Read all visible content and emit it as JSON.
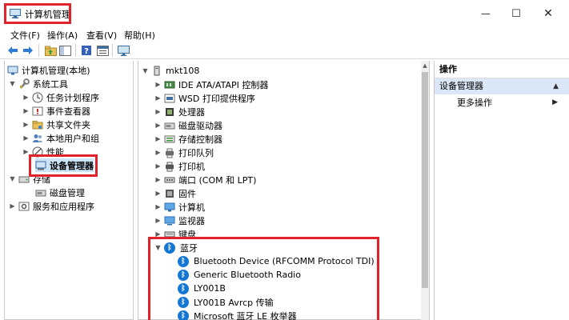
{
  "window": {
    "title": "计算机管理",
    "minimize_glyph": "—",
    "maximize_glyph": "☐",
    "close_glyph": "✕"
  },
  "menu": [
    "文件(F)",
    "操作(A)",
    "查看(V)",
    "帮助(H)"
  ],
  "toolbar": {
    "icons": [
      "back-arrow-icon",
      "forward-arrow-icon",
      "up-folder-icon",
      "show-hide-tree-icon",
      "help-icon",
      "properties-icon",
      "console-icon"
    ]
  },
  "left_tree": {
    "root": "计算机管理(本地)",
    "system_tools": "系统工具",
    "task_scheduler": "任务计划程序",
    "event_viewer": "事件查看器",
    "shared_folders": "共享文件夹",
    "local_users": "本地用户和组",
    "performance": "性能",
    "device_manager": "设备管理器",
    "storage": "存储",
    "disk_management": "磁盘管理",
    "services_apps": "服务和应用程序"
  },
  "center_tree": {
    "computer_name": "mkt108",
    "categories": [
      "IDE ATA/ATAPI 控制器",
      "WSD 打印提供程序",
      "处理器",
      "磁盘驱动器",
      "存储控制器",
      "打印队列",
      "打印机",
      "端口 (COM 和 LPT)",
      "固件",
      "计算机",
      "监视器",
      "键盘"
    ],
    "bluetooth": "蓝牙",
    "bluetooth_devices": [
      "Bluetooth Device (RFCOMM Protocol TDI)",
      "Generic Bluetooth Radio",
      "LY001B",
      "LY001B Avrcp 传输",
      "Microsoft 蓝牙 LE 枚举器"
    ]
  },
  "actions": {
    "header": "操作",
    "section": "设备管理器",
    "more": "更多操作"
  },
  "colors": {
    "highlight_red": "#e0232a",
    "bluetooth_blue": "#1477d4",
    "action_section_bg": "#dbe7f6",
    "desktop_blue": "#1f4fa8"
  }
}
